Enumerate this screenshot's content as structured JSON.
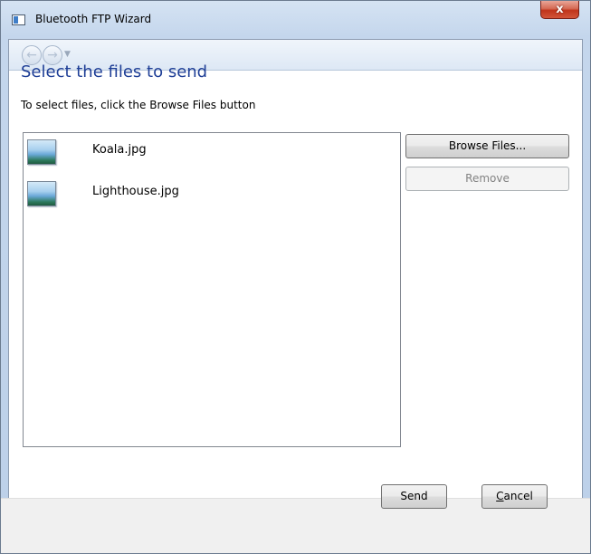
{
  "window": {
    "title": "Bluetooth FTP Wizard",
    "close_glyph": "x"
  },
  "nav": {
    "back_icon": "back-arrow-icon",
    "forward_icon": "forward-arrow-icon",
    "dropdown_icon": "chevron-down-icon"
  },
  "page": {
    "heading": "Select the files to send",
    "instruction": "To select files, click the Browse Files button"
  },
  "files": [
    {
      "name": "Koala.jpg",
      "icon": "image-file-icon"
    },
    {
      "name": "Lighthouse.jpg",
      "icon": "image-file-icon"
    }
  ],
  "buttons": {
    "browse_label": "Browse Files...",
    "remove_label": "Remove",
    "remove_enabled": false,
    "send_label": "Send",
    "cancel_label_accel": "C",
    "cancel_label_rest": "ancel"
  },
  "colors": {
    "heading": "#1e3e96",
    "close_button": "#c0341b",
    "frame": "#c4d6ec"
  }
}
